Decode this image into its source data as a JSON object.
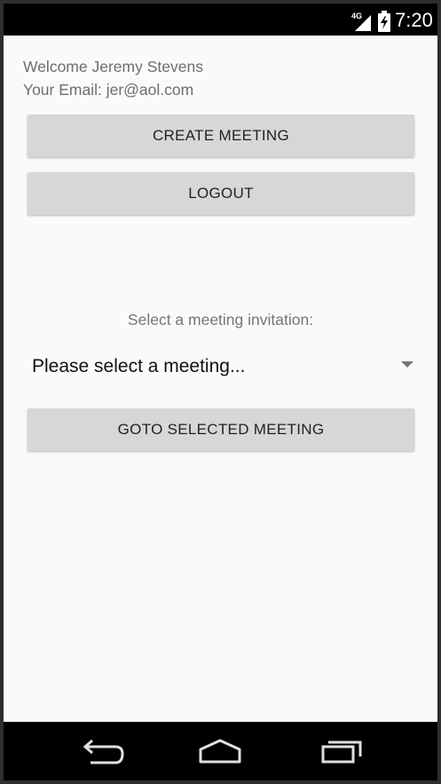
{
  "status_bar": {
    "network_label": "4G",
    "time": "7:20",
    "icons": [
      "signal-4g-icon",
      "battery-charging-icon"
    ]
  },
  "header": {
    "welcome": "Welcome Jeremy Stevens",
    "email": "Your Email: jer@aol.com"
  },
  "actions": {
    "create_meeting": "CREATE MEETING",
    "logout": "LOGOUT",
    "goto_selected": "GOTO SELECTED MEETING"
  },
  "meeting_select": {
    "label": "Select a meeting invitation:",
    "selected_value": "Please select a meeting..."
  },
  "nav_bar": {
    "icons": [
      "back-icon",
      "home-icon",
      "recents-icon"
    ]
  },
  "colors": {
    "background": "#fafafa",
    "button": "#d6d7d7",
    "status_bar": "#000000"
  }
}
